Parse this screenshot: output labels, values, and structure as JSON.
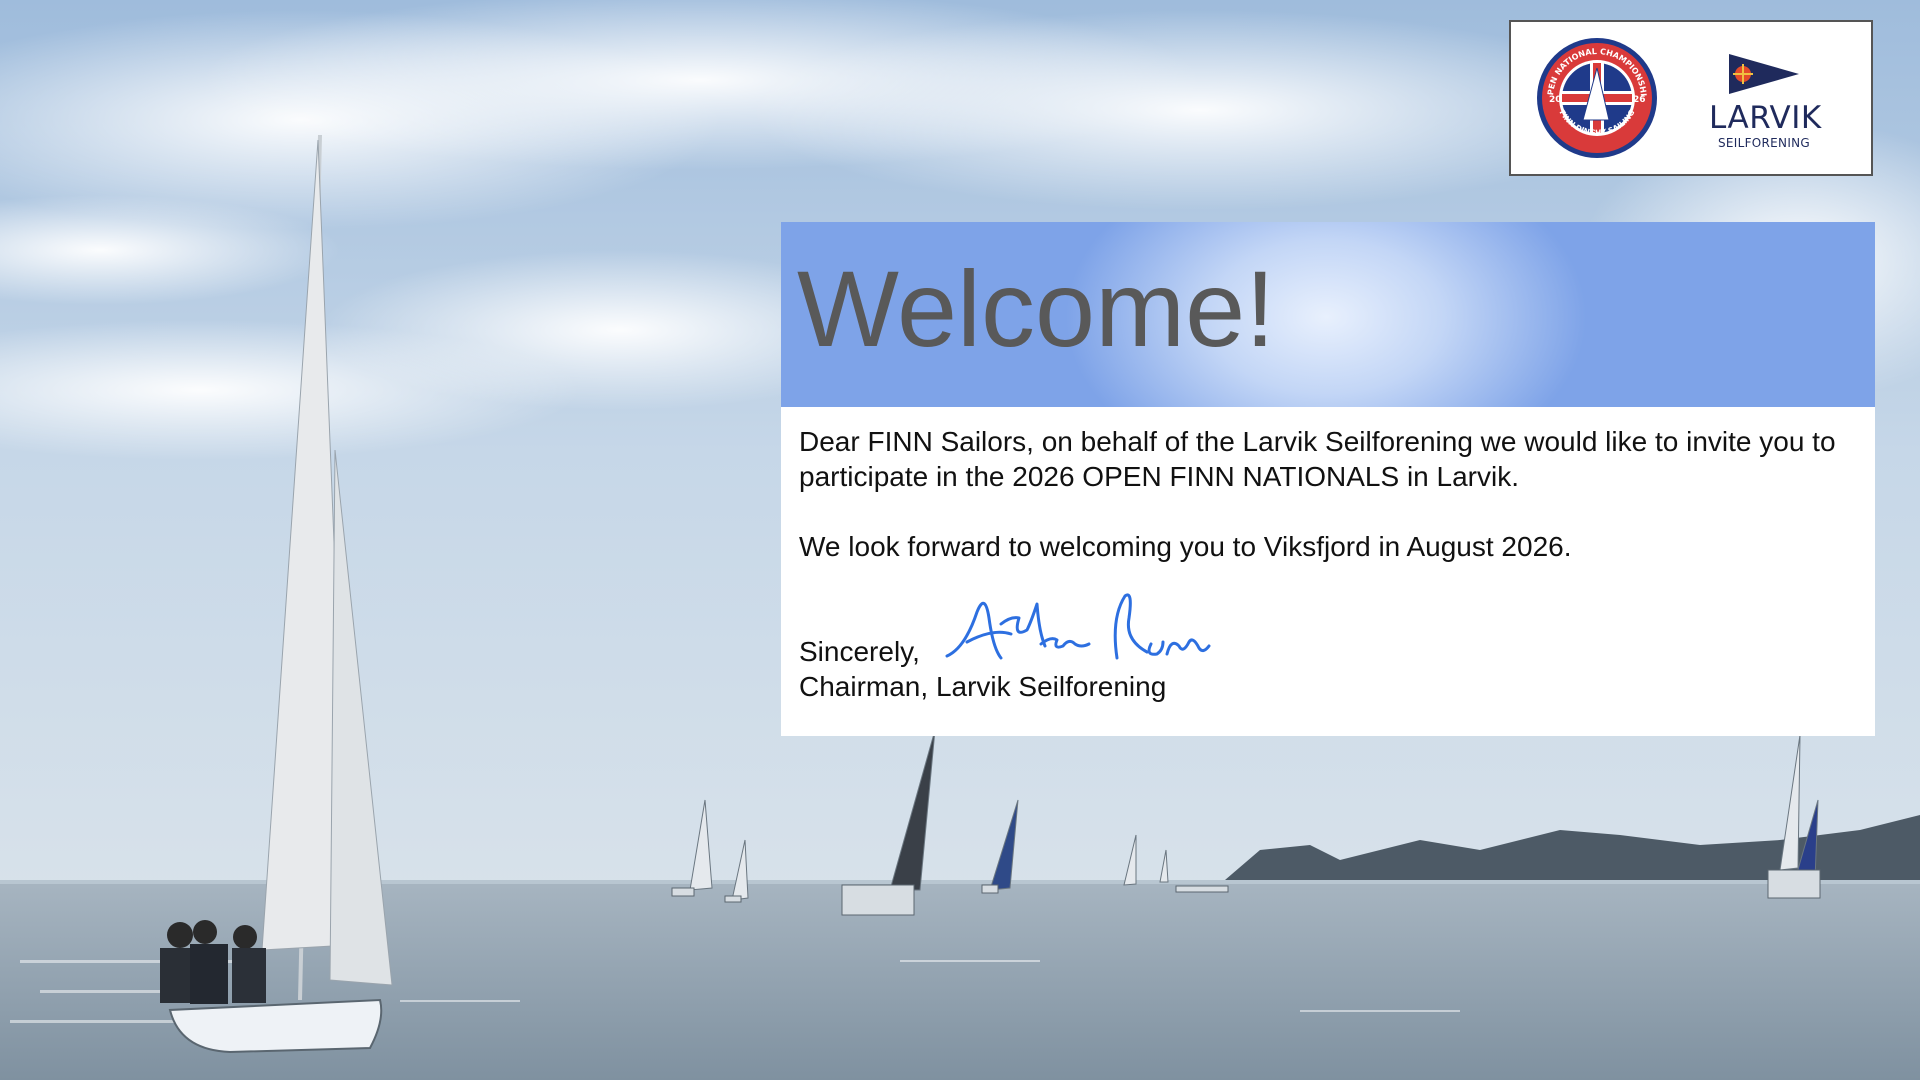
{
  "logos": {
    "finn_badge": {
      "ring_top_text": "OPEN NATIONAL CHAMPIONSHIP",
      "ring_bottom_text": "FINN DINGHY SAILING",
      "year_left": "20",
      "year_right": "26",
      "icon": "finn-championship-badge-icon",
      "colors": {
        "ring": "#d93a3a",
        "inner": "#1f3a8a"
      }
    },
    "larvik": {
      "name": "LARVIK",
      "subtitle": "SEILFORENING",
      "icon": "larvik-burgee-icon",
      "colors": {
        "flag": "#1f2a5c",
        "cross": "#e44b2a"
      }
    }
  },
  "card": {
    "title": "Welcome!",
    "paragraph1": "Dear FINN Sailors, on behalf of the Larvik Seilforening we would like to invite you to participate in the 2026 OPEN FINN NATIONALS in Larvik.",
    "paragraph2": "We look forward to welcoming you to Viksfjord in August 2026.",
    "sign_off": "Sincerely,",
    "signature_text": "Asbjørn Nam",
    "signer_title": "Chairman, Larvik Seilforening",
    "colors": {
      "header_edge": "#7ea3e8",
      "header_center": "#e8f0fd",
      "title": "#595959",
      "signature": "#2d6fe0"
    }
  },
  "background": {
    "icon": "sailing-regatta-photo",
    "colors": {
      "sky": "#b9cfe6",
      "sea": "#8d9fae"
    }
  }
}
